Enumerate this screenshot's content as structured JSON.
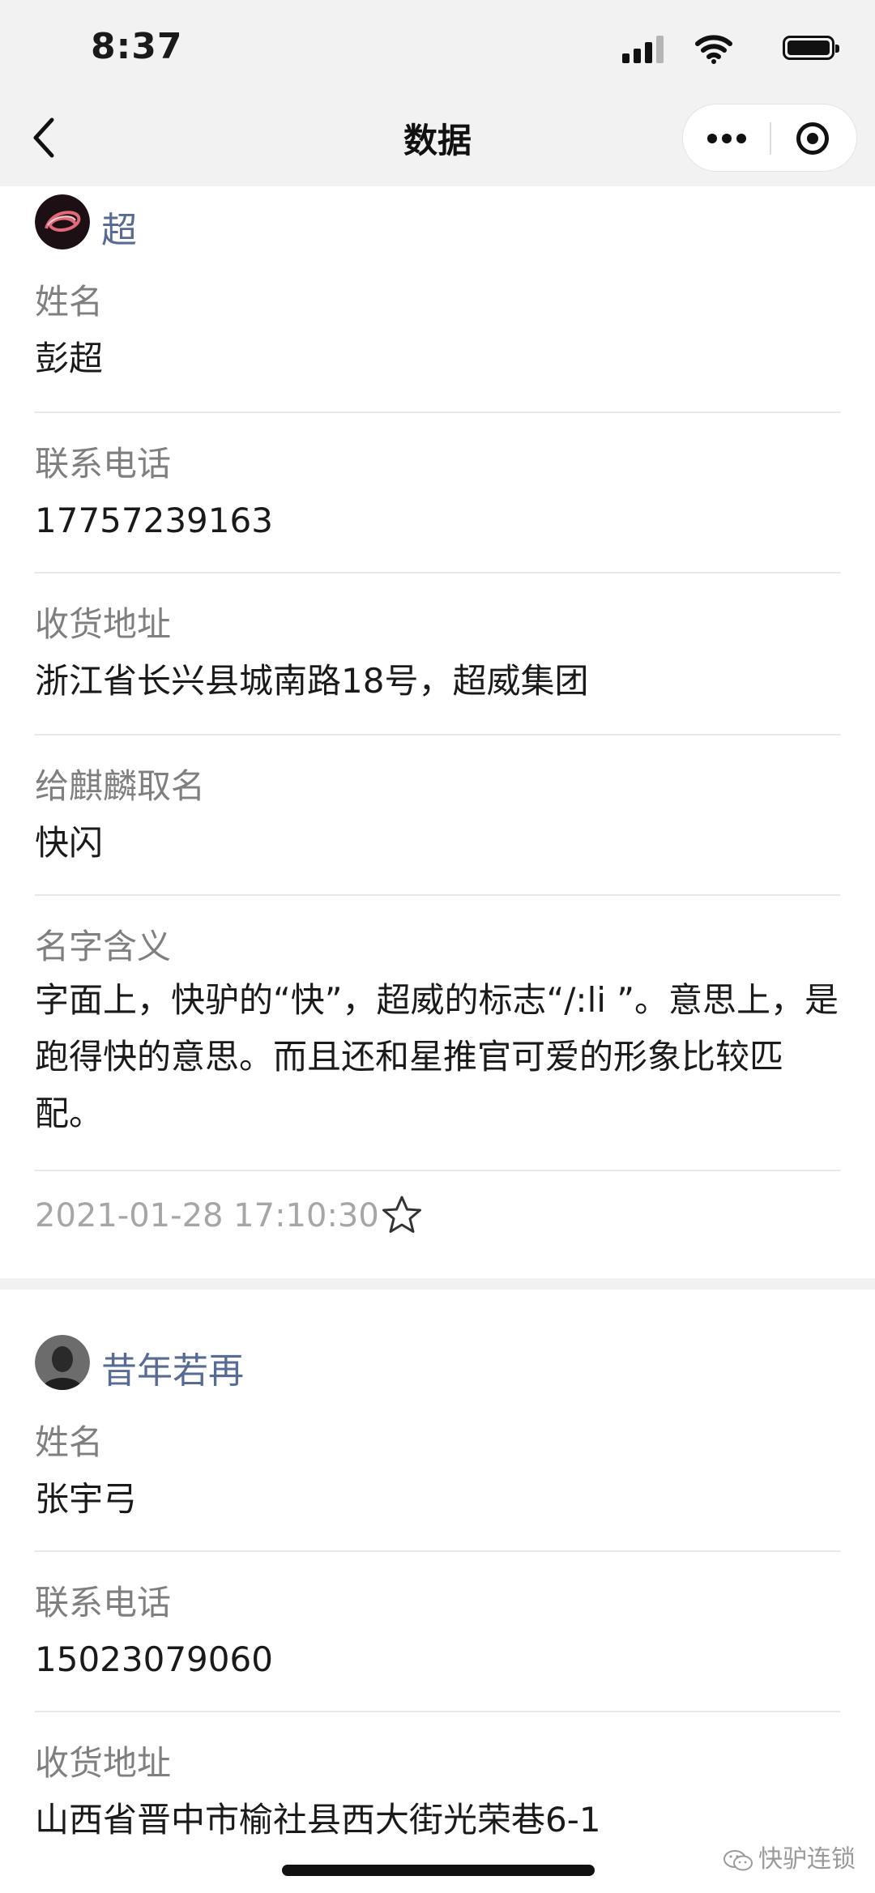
{
  "status_bar": {
    "time": "8:37"
  },
  "nav": {
    "title": "数据"
  },
  "entries": [
    {
      "username": "超",
      "fields": [
        {
          "label": "姓名",
          "value": "彭超"
        },
        {
          "label": "联系电话",
          "value": "17757239163"
        },
        {
          "label": "收货地址",
          "value": "浙江省长兴县城南路18号，超威集团"
        },
        {
          "label": "给麒麟取名",
          "value": "快闪"
        },
        {
          "label": "名字含义",
          "value": "字面上，快驴的“快”，超威的标志“/:li ”。意思上，是跑得快的意思。而且还和星推官可爱的形象比较匹配。"
        }
      ],
      "timestamp": "2021-01-28 17:10:30"
    },
    {
      "username": "昔年若再",
      "fields": [
        {
          "label": "姓名",
          "value": "张宇弓"
        },
        {
          "label": "联系电话",
          "value": "15023079060"
        },
        {
          "label": "收货地址",
          "value": "山西省晋中市榆社县西大街光荣巷6-1"
        }
      ]
    }
  ],
  "watermark": "快驴连锁",
  "colors": {
    "username": "#576b95",
    "label": "#7f7f7f",
    "nav_bg": "#f2f2f2"
  }
}
